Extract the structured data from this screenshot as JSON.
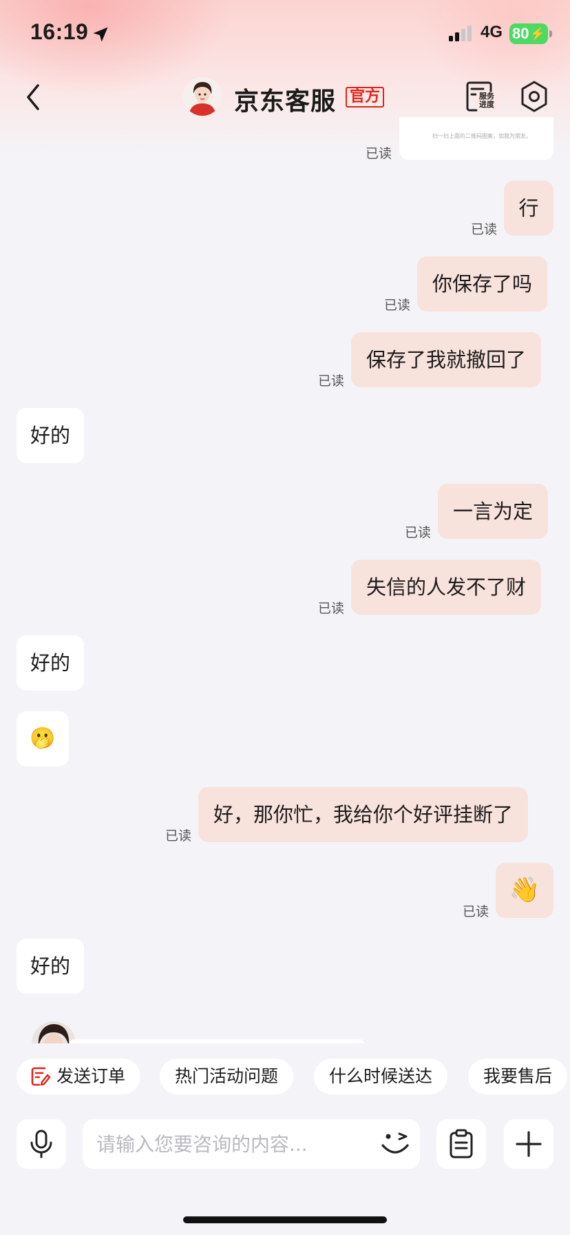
{
  "status_bar": {
    "time": "16:19",
    "network": "4G",
    "battery": "80"
  },
  "header": {
    "title": "京东客服",
    "badge": "官方",
    "service_progress_label": "服务进度"
  },
  "messages": {
    "partial_card_text": "扫一扫上面的二维码图案，加我为朋友。",
    "read_label": "已读",
    "m1": "行",
    "m2": "你保存了吗",
    "m3": "保存了我就撤回了",
    "m4": "好的",
    "m5": "一言为定",
    "m6": "失信的人发不了财",
    "m7": "好的",
    "m8": "🫢",
    "m9": "好，那你忙，我给你个好评挂断了",
    "m10": "👋",
    "m11": "好的"
  },
  "quick_actions": [
    "发送订单",
    "热门活动问题",
    "什么时候送达",
    "我要售后"
  ],
  "input": {
    "placeholder": "请输入您要咨询的内容..."
  },
  "colors": {
    "accent": "#e2231a",
    "sent_bubble": "#f8e2dc",
    "background": "#f4f4f8"
  },
  "icons": [
    "back-arrow-icon",
    "avatar",
    "service-progress-icon",
    "settings-icon",
    "order-icon",
    "microphone-icon",
    "wink-emoji-icon",
    "clipboard-icon",
    "plus-icon"
  ]
}
